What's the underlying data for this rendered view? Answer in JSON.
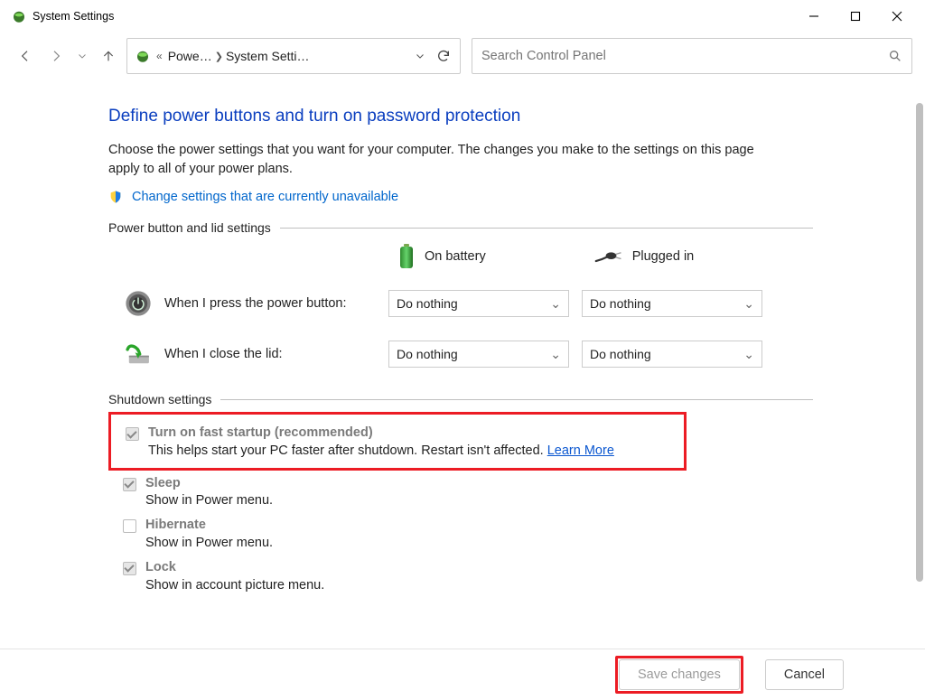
{
  "window": {
    "title": "System Settings"
  },
  "breadcrumb": {
    "segments": [
      "Powe…",
      "System Setti…"
    ]
  },
  "search": {
    "placeholder": "Search Control Panel"
  },
  "page": {
    "title": "Define power buttons and turn on password protection",
    "description": "Choose the power settings that you want for your computer. The changes you make to the settings on this page apply to all of your power plans.",
    "change_link": "Change settings that are currently unavailable"
  },
  "sections": {
    "power_lid_header": "Power button and lid settings",
    "shutdown_header": "Shutdown settings"
  },
  "columns": {
    "battery": "On battery",
    "plugged": "Plugged in"
  },
  "rows": {
    "power_button_label": "When I press the power button:",
    "power_button_battery": "Do nothing",
    "power_button_plugged": "Do nothing",
    "lid_label": "When I close the lid:",
    "lid_battery": "Do nothing",
    "lid_plugged": "Do nothing"
  },
  "shutdown": {
    "fast": {
      "title": "Turn on fast startup (recommended)",
      "sub": "This helps start your PC faster after shutdown. Restart isn't affected. ",
      "learn": "Learn More"
    },
    "sleep": {
      "title": "Sleep",
      "sub": "Show in Power menu."
    },
    "hibernate": {
      "title": "Hibernate",
      "sub": "Show in Power menu."
    },
    "lock": {
      "title": "Lock",
      "sub": "Show in account picture menu."
    }
  },
  "footer": {
    "save": "Save changes",
    "cancel": "Cancel"
  }
}
